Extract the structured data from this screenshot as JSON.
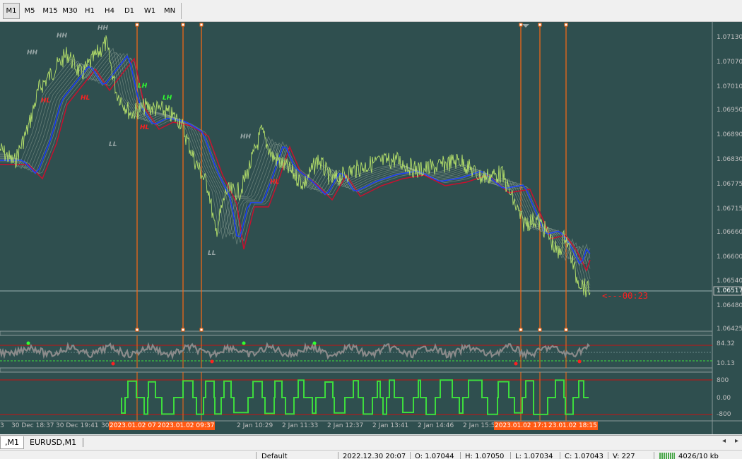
{
  "timeframes": [
    "M1",
    "M5",
    "M15",
    "M30",
    "H1",
    "H4",
    "D1",
    "W1",
    "MN"
  ],
  "active_timeframe": "M1",
  "price_axis": [
    "1.07130",
    "1.07070",
    "1.07010",
    "1.06950",
    "1.06890",
    "1.06830",
    "1.06775",
    "1.06715",
    "1.06660",
    "1.06600",
    "1.06540",
    "1.06480",
    "1.06425"
  ],
  "current_price": "1.06517",
  "countdown": "<---00:23",
  "rsi_axis": {
    "top": "84.32",
    "bottom": "10.13"
  },
  "histo_axis": {
    "top": "800",
    "mid": "0.00",
    "bottom": "-800"
  },
  "time_axis": [
    {
      "label": "3"
    },
    {
      "label": "30 Dec 18:37"
    },
    {
      "label": "30 Dec 19:41"
    },
    {
      "label": "30"
    },
    {
      "label": "2 Jan 10:29"
    },
    {
      "label": "2 Jan 11:33"
    },
    {
      "label": "2 Jan 12:37"
    },
    {
      "label": "2 Jan 13:41"
    },
    {
      "label": "2 Jan 14:46"
    },
    {
      "label": "2 Jan 15:5"
    }
  ],
  "time_highlights": [
    "2023.01.02 07:",
    "2023.01.02 09:37",
    "2023.01.02 17:11",
    "23.01.02 18:15"
  ],
  "swing_labels": [
    {
      "t": "HH",
      "c": "gray"
    },
    {
      "t": "HH",
      "c": "gray"
    },
    {
      "t": "HH",
      "c": "gray"
    },
    {
      "t": "HH",
      "c": "gray"
    },
    {
      "t": "HL",
      "c": "red"
    },
    {
      "t": "HL",
      "c": "red"
    },
    {
      "t": "HL",
      "c": "red"
    },
    {
      "t": "HL",
      "c": "red"
    },
    {
      "t": "LH",
      "c": "green"
    },
    {
      "t": "LH",
      "c": "green"
    },
    {
      "t": "LL",
      "c": "gray"
    },
    {
      "t": "LL",
      "c": "gray"
    }
  ],
  "chart_tabs": [
    {
      "label": ",M1",
      "active": true
    },
    {
      "label": "EURUSD,M1",
      "active": false
    }
  ],
  "status": {
    "profile": "Default",
    "datetime": "2022.12.30 20:07",
    "open": "O: 1.07044",
    "high": "H: 1.07050",
    "low": "L: 1.07034",
    "close": "C: 1.07043",
    "volume": "V: 227",
    "traffic": "4026/10 kb"
  },
  "colors": {
    "background": "#2f4f4f",
    "price_line": "#b5e06a",
    "ma_blue": "#1a3cff",
    "ma_red": "#c8102e",
    "vertical_line": "#ff6a13",
    "rsi_line": "#8a8a8a",
    "histogram": "#3ddc3d",
    "label_red": "#ff2020",
    "label_green": "#30ff30",
    "label_gray": "#9aa8a8"
  }
}
